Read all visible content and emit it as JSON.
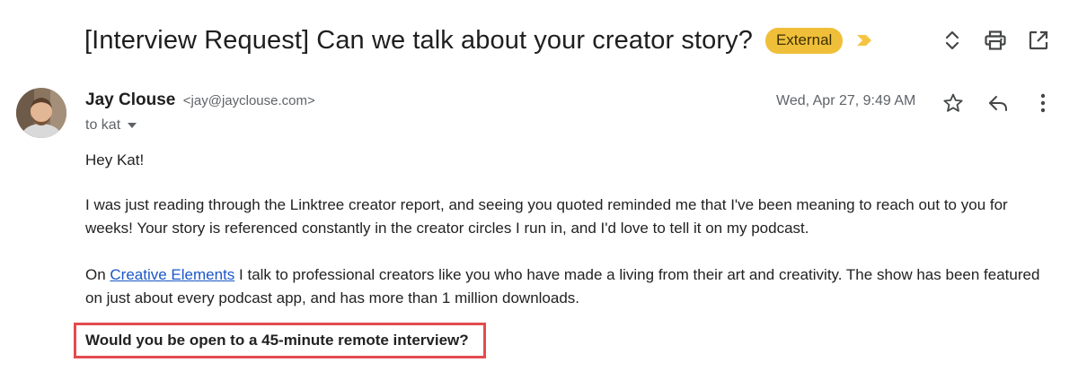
{
  "subject": {
    "title": "[Interview Request] Can we talk about your creator story?",
    "badge": "External",
    "importance_icon": "importance-marker-icon",
    "colors": {
      "badge_bg": "#f0bf3a",
      "importance": "#f5c542"
    }
  },
  "toolbar": {
    "icons": [
      "expand-collapse-icon",
      "print-icon",
      "open-in-new-window-icon"
    ]
  },
  "message": {
    "sender_name": "Jay Clouse",
    "sender_email": "<jay@jayclouse.com>",
    "to": "to kat",
    "date": "Wed, Apr 27, 9:49 AM",
    "actions": [
      "star-icon",
      "reply-icon",
      "more-vert-icon"
    ]
  },
  "body": {
    "greeting": "Hey Kat!",
    "para1": "I was just reading through the Linktree creator report, and seeing you quoted reminded me that I've been meaning to reach out to you for weeks! Your story is referenced constantly in the creator circles I run in, and I'd love to tell it on my podcast.",
    "para2_prefix": "On ",
    "para2_link": "Creative Elements",
    "para2_suffix": " I talk to professional creators like you who have made a living from their art and creativity. The show has been featured on just about every podcast app, and has more than 1 million downloads.",
    "question": "Would you be open to a 45-minute remote interview?",
    "colors": {
      "link": "#1a56c8",
      "highlight_border": "#e34b4f"
    }
  }
}
